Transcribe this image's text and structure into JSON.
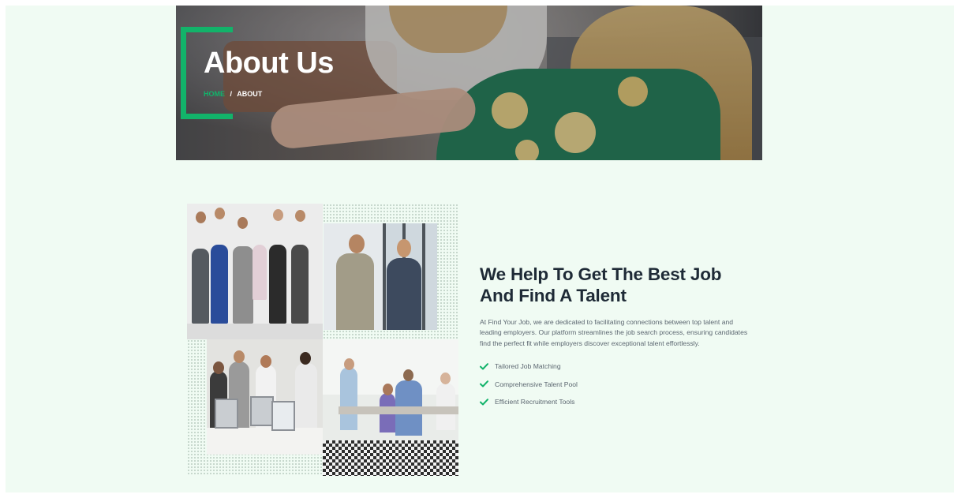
{
  "hero": {
    "title": "About Us",
    "breadcrumb": {
      "home": "Home",
      "separator": "/",
      "current": "ABOUT"
    }
  },
  "about": {
    "heading_line1": "We Help To Get The Best Job",
    "heading_line2": "And Find A Talent",
    "description": "At Find Your Job, we are dedicated to facilitating connections between top talent and leading employers. Our platform streamlines the job search process, ensuring candidates find the perfect fit while employers discover exceptional talent effortlessly.",
    "features": [
      {
        "icon": "check-icon",
        "label": "Tailored Job Matching"
      },
      {
        "icon": "check-icon",
        "label": "Comprehensive Talent Pool"
      },
      {
        "icon": "check-icon",
        "label": "Efficient Recruitment Tools"
      }
    ]
  },
  "colors": {
    "accent": "#12b36a",
    "page_background": "#f0fbf3",
    "heading": "#1e2a36",
    "body_text": "#5b6670"
  }
}
